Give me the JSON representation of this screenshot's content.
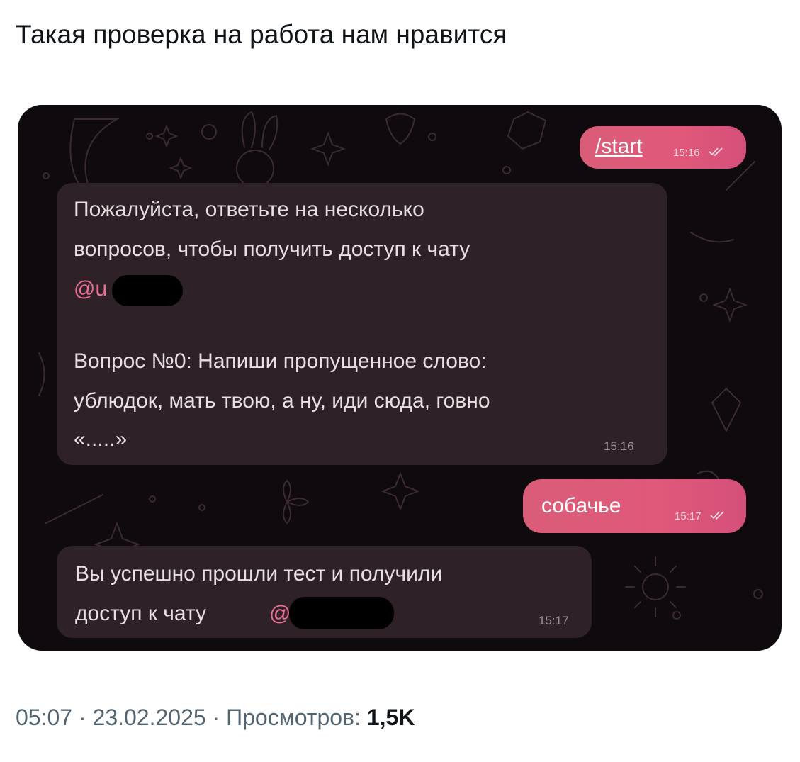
{
  "post": {
    "text": "Такая проверка на работа нам нравится"
  },
  "chat": {
    "messages": [
      {
        "id": "out1",
        "direction": "outgoing",
        "text": "/start",
        "time": "15:16"
      },
      {
        "id": "in1",
        "direction": "incoming",
        "lines": [
          "Пожалуйста, ответьте на несколько",
          "вопросов, чтобы получить доступ к чату"
        ],
        "mention": "@u",
        "lines2": [
          "Вопрос №0: Напиши пропущенное слово:",
          "ублюдок, мать твою, а ну, иди сюда, говно",
          "«.....»"
        ],
        "time": "15:16"
      },
      {
        "id": "out2",
        "direction": "outgoing",
        "text": "собачье",
        "time": "15:17"
      },
      {
        "id": "in2",
        "direction": "incoming",
        "lines": [
          "Вы успешно прошли тест и получили",
          "доступ к чату"
        ],
        "mention": "@",
        "time": "15:17"
      }
    ],
    "colors": {
      "outgoing_bubble": "#e0587a",
      "incoming_bubble": "#2e2228",
      "mention": "#ec6f93",
      "background": "#0f0a0e"
    }
  },
  "meta": {
    "time": "05:07",
    "sep1": " · ",
    "date": "23.02.2025",
    "sep2": " · ",
    "views_label": "Просмотров: ",
    "views_count": "1,5K"
  }
}
